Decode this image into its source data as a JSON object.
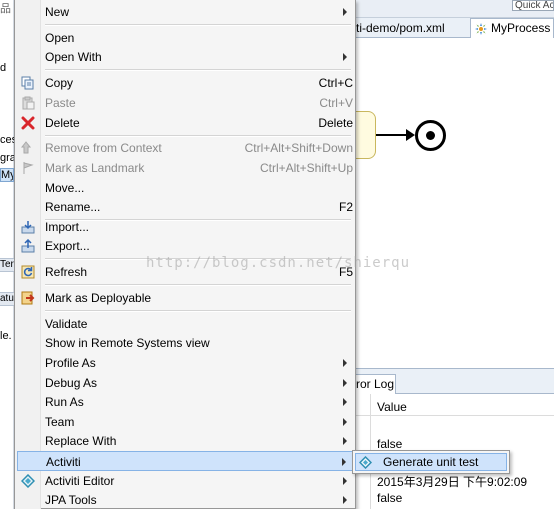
{
  "background": {
    "quick_access": "Quick Ac",
    "tab_pom": "ti-demo/pom.xml",
    "tab_process": "MyProcess",
    "error_log_tab": "ror Log",
    "props_value_header": "Value",
    "props_values": [
      "false",
      "2015年3月29日 下午9:02:09",
      "false"
    ],
    "left_fragments": [
      "d",
      "ces",
      "gra",
      "My",
      "Ter",
      "atu",
      "le."
    ]
  },
  "menu": {
    "items": [
      {
        "label": "New",
        "shortcut": "",
        "submenu": true,
        "disabled": false,
        "icon": ""
      },
      {
        "label": "Open",
        "shortcut": "",
        "submenu": false,
        "disabled": false,
        "icon": ""
      },
      {
        "label": "Open With",
        "shortcut": "",
        "submenu": true,
        "disabled": false,
        "icon": ""
      },
      {
        "label": "Copy",
        "shortcut": "Ctrl+C",
        "submenu": false,
        "disabled": false,
        "icon": "copy-icon"
      },
      {
        "label": "Paste",
        "shortcut": "Ctrl+V",
        "submenu": false,
        "disabled": true,
        "icon": "paste-icon"
      },
      {
        "label": "Delete",
        "shortcut": "Delete",
        "submenu": false,
        "disabled": false,
        "icon": "delete-icon"
      },
      {
        "label": "Remove from Context",
        "shortcut": "Ctrl+Alt+Shift+Down",
        "submenu": false,
        "disabled": true,
        "icon": "remove-context-icon"
      },
      {
        "label": "Mark as Landmark",
        "shortcut": "Ctrl+Alt+Shift+Up",
        "submenu": false,
        "disabled": true,
        "icon": "landmark-icon"
      },
      {
        "label": "Move...",
        "shortcut": "",
        "submenu": false,
        "disabled": false,
        "icon": ""
      },
      {
        "label": "Rename...",
        "shortcut": "F2",
        "submenu": false,
        "disabled": false,
        "icon": ""
      },
      {
        "label": "Import...",
        "shortcut": "",
        "submenu": false,
        "disabled": false,
        "icon": "import-icon"
      },
      {
        "label": "Export...",
        "shortcut": "",
        "submenu": false,
        "disabled": false,
        "icon": "export-icon"
      },
      {
        "label": "Refresh",
        "shortcut": "F5",
        "submenu": false,
        "disabled": false,
        "icon": "refresh-icon"
      },
      {
        "label": "Mark as Deployable",
        "shortcut": "",
        "submenu": false,
        "disabled": false,
        "icon": "deployable-icon"
      },
      {
        "label": "Validate",
        "shortcut": "",
        "submenu": false,
        "disabled": false,
        "icon": ""
      },
      {
        "label": "Show in Remote Systems view",
        "shortcut": "",
        "submenu": false,
        "disabled": false,
        "icon": ""
      },
      {
        "label": "Profile As",
        "shortcut": "",
        "submenu": true,
        "disabled": false,
        "icon": ""
      },
      {
        "label": "Debug As",
        "shortcut": "",
        "submenu": true,
        "disabled": false,
        "icon": ""
      },
      {
        "label": "Run As",
        "shortcut": "",
        "submenu": true,
        "disabled": false,
        "icon": ""
      },
      {
        "label": "Team",
        "shortcut": "",
        "submenu": true,
        "disabled": false,
        "icon": ""
      },
      {
        "label": "Replace With",
        "shortcut": "",
        "submenu": true,
        "disabled": false,
        "icon": ""
      },
      {
        "label": "Activiti",
        "shortcut": "",
        "submenu": true,
        "disabled": false,
        "icon": "",
        "highlighted": true
      },
      {
        "label": "Activiti Editor",
        "shortcut": "",
        "submenu": true,
        "disabled": false,
        "icon": "activiti-editor-icon"
      },
      {
        "label": "JPA Tools",
        "shortcut": "",
        "submenu": true,
        "disabled": false,
        "icon": ""
      }
    ]
  },
  "submenu": {
    "item_label": "Generate unit test",
    "item_icon": "activiti-diamond-icon"
  },
  "watermark": "http://blog.csdn.net/shierqu",
  "colors": {
    "menu_bg": "#f5f5f5",
    "highlight_bg": "#cfe3fb",
    "highlight_border": "#86b3e6",
    "disabled_text": "#8a8a8a",
    "delete_red": "#d9262c",
    "task_fill": "#fffbe0"
  }
}
